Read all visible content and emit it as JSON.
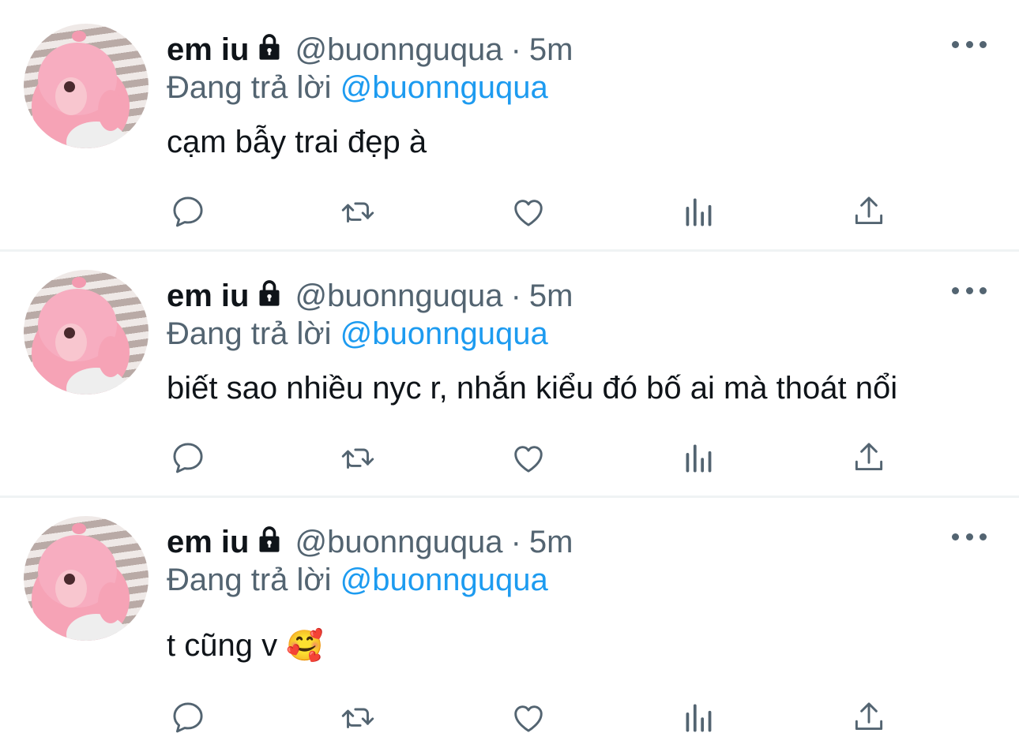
{
  "icons": {
    "lock": "lock-icon",
    "reply": "reply-icon",
    "retweet": "retweet-icon",
    "like": "heart-icon",
    "views": "views-icon",
    "share": "share-icon",
    "more": "more-icon",
    "emoji": "smiling-face-with-hearts"
  },
  "colors": {
    "text": "#0f1419",
    "secondary": "#536471",
    "mention": "#1d9bf0",
    "divider": "#eff3f4"
  },
  "tweets": [
    {
      "name": "em iu",
      "handle": "@buonnguqua",
      "dot": "·",
      "time": "5m",
      "reply_prefix": "Đang trả lời",
      "reply_to": "@buonnguqua",
      "text": "cạm bẫy trai đẹp à",
      "emoji": ""
    },
    {
      "name": "em iu",
      "handle": "@buonnguqua",
      "dot": "·",
      "time": "5m",
      "reply_prefix": "Đang trả lời",
      "reply_to": "@buonnguqua",
      "text": "biết sao nhiều nyc r, nhắn kiểu đó bố ai mà thoát nổi",
      "emoji": ""
    },
    {
      "name": "em iu",
      "handle": "@buonnguqua",
      "dot": "·",
      "time": "5m",
      "reply_prefix": "Đang trả lời",
      "reply_to": "@buonnguqua",
      "text": "t cũng v ",
      "emoji": "🥰"
    }
  ]
}
